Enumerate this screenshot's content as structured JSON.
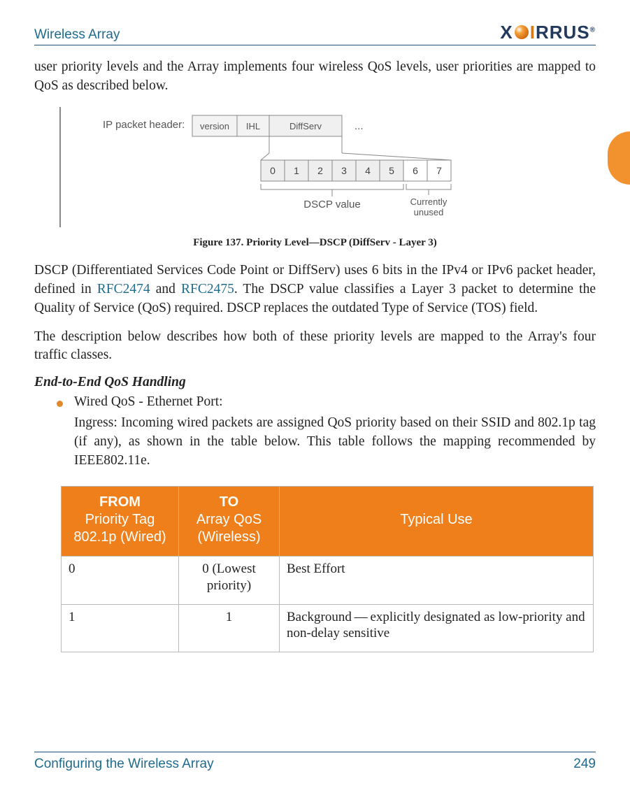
{
  "header": {
    "title": "Wireless Array",
    "logo_text_1": "X",
    "logo_text_i": "I",
    "logo_text_2": "RRUS",
    "logo_reg": "®"
  },
  "intro": "user priority levels and the Array implements four wireless QoS levels, user priorities are mapped to QoS as described below.",
  "figure": {
    "ip_label": "IP packet header:",
    "cell_version": "version",
    "cell_ihl": "IHL",
    "cell_diffserv": "DiffServ",
    "dots": "...",
    "bits": [
      "0",
      "1",
      "2",
      "3",
      "4",
      "5",
      "6",
      "7"
    ],
    "dscp_label": "DSCP value",
    "unused_l1": "Currently",
    "unused_l2": "unused",
    "caption": "Figure 137. Priority Level—DSCP (DiffServ - Layer 3)"
  },
  "para1_a": "DSCP (Differentiated Services Code Point or DiffServ) uses 6 bits in the IPv4 or IPv6 packet header, defined in ",
  "para1_link1": "RFC2474",
  "para1_b": " and ",
  "para1_link2": "RFC2475",
  "para1_c": ". The DSCP value classifies a Layer 3 packet to determine the Quality of Service (QoS) required. DSCP replaces the outdated Type of Service (TOS) field.",
  "para2": "The description below describes how both of these priority levels are mapped to the Array's four traffic classes.",
  "subheading": "End-to-End QoS Handling",
  "bullet": {
    "title": "Wired QoS - Ethernet Port:",
    "para": "Ingress: Incoming wired packets are assigned QoS priority based on their SSID and 802.1p tag (if any), as shown in the table below. This table follows the mapping recommended by IEEE802.11e."
  },
  "table": {
    "col1_top": "FROM",
    "col1_sub": "Priority Tag 802.1p (Wired)",
    "col2_top": "TO",
    "col2_sub": "Array QoS (Wireless)",
    "col3": "Typical Use",
    "rows": [
      {
        "from": "0",
        "to": "0 (Lowest priority)",
        "use": "Best Effort"
      },
      {
        "from": "1",
        "to": "1",
        "use": "Background — explicitly designated as low-priority and non-delay sensitive"
      }
    ]
  },
  "footer": {
    "left": "Configuring the Wireless Array",
    "right": "249"
  }
}
